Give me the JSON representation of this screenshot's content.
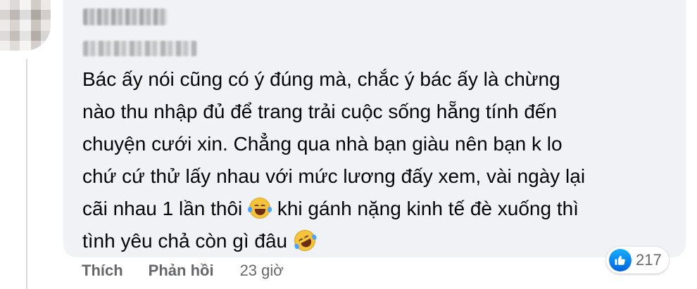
{
  "comment": {
    "lines": [
      "Bác ấy nói cũng có ý đúng mà, chắc ý bác ấy là chừng",
      "nào thu nhập đủ để trang trải cuộc sống hẵng tính đến",
      "chuyện cưới xin. Chẳng qua nhà bạn giàu nên bạn k lo",
      "chứ cứ thử lấy nhau với mức lương đấy xem, vài ngày lại"
    ],
    "line5_before_emoji": "cãi nhau 1 lần thôi ",
    "line5_after_emoji": " khi gánh nặng kinh tế đè xuống thì",
    "line6": "tình yêu chả còn gì đâu ",
    "emoji_1": "crying-laughing-emoji",
    "emoji_2": "rolling-laughing-emoji"
  },
  "reactions": {
    "icon": "like-icon",
    "count": "217",
    "color": "#1877f2"
  },
  "actions": {
    "like_label": "Thích",
    "reply_label": "Phản hồi",
    "time": "23 giờ"
  }
}
